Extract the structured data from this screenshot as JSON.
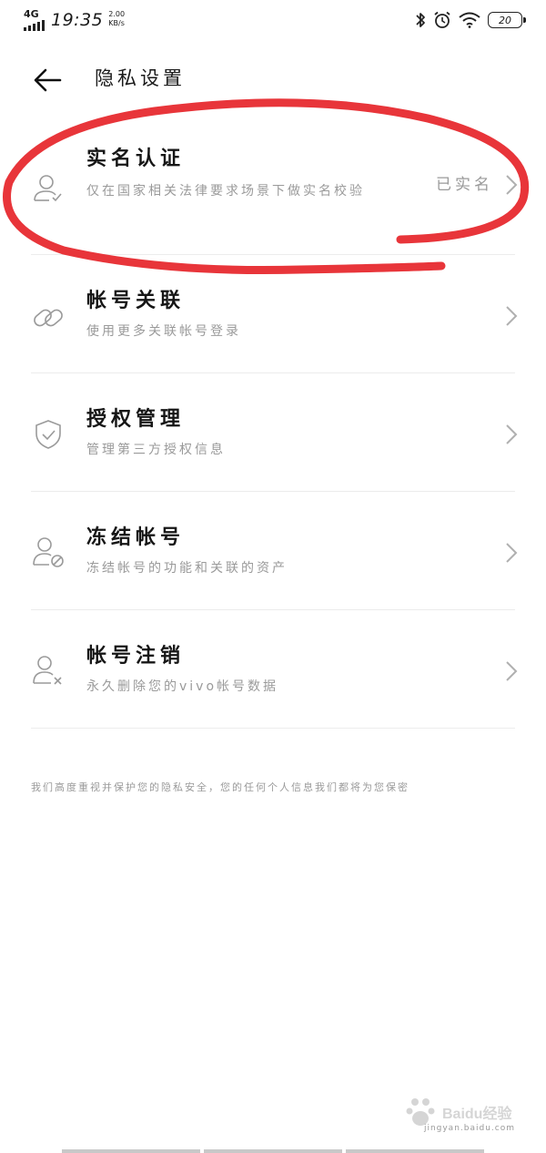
{
  "status_bar": {
    "network": "4G",
    "time": "19:35",
    "speed_value": "2.00",
    "speed_unit": "KB/s",
    "battery": "20",
    "icons": [
      "bluetooth-icon",
      "alarm-icon",
      "wifi-icon",
      "battery-icon"
    ]
  },
  "header": {
    "title": "隐私设置"
  },
  "items": [
    {
      "title": "实名认证",
      "subtitle": "仅在国家相关法律要求场景下做实名校验",
      "status": "已实名",
      "icon": "person-check-icon"
    },
    {
      "title": "帐号关联",
      "subtitle": "使用更多关联帐号登录",
      "status": "",
      "icon": "link-icon"
    },
    {
      "title": "授权管理",
      "subtitle": "管理第三方授权信息",
      "status": "",
      "icon": "shield-check-icon"
    },
    {
      "title": "冻结帐号",
      "subtitle": "冻结帐号的功能和关联的资产",
      "status": "",
      "icon": "person-block-icon"
    },
    {
      "title": "帐号注销",
      "subtitle": "永久删除您的vivo帐号数据",
      "status": "",
      "icon": "person-remove-icon"
    }
  ],
  "footer_note": "我们高度重视并保护您的隐私安全，您的任何个人信息我们都将为您保密",
  "watermark": {
    "brand": "Baidu经验",
    "url": "jingyan.baidu.com"
  },
  "colors": {
    "annotation": "#e8353a",
    "secondary_text": "#9a9a9a"
  }
}
